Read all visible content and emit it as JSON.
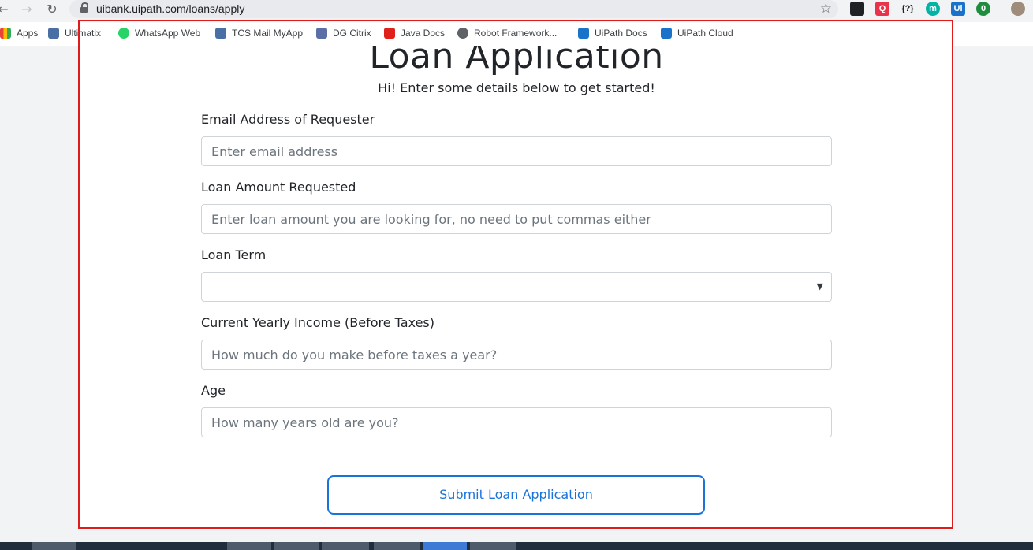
{
  "browser": {
    "url": "uibank.uipath.com/loans/apply",
    "extensions": [
      "Q",
      "{?}",
      "m",
      "Ui",
      "0"
    ]
  },
  "bookmarks": [
    {
      "label": "Apps",
      "icon": "apps-grid-icon"
    },
    {
      "label": "Ultimatix",
      "icon": "tata-icon"
    },
    {
      "label": "WhatsApp Web",
      "icon": "whatsapp-icon"
    },
    {
      "label": "TCS Mail MyApp",
      "icon": "tata-icon"
    },
    {
      "label": "DG Citrix",
      "icon": "lock-icon"
    },
    {
      "label": "Java Docs",
      "icon": "oracle-icon"
    },
    {
      "label": "Robot Framework...",
      "icon": "globe-icon"
    },
    {
      "label": "UiPath Docs",
      "icon": "uipath-icon"
    },
    {
      "label": "UiPath Cloud",
      "icon": "uipath-icon"
    }
  ],
  "form": {
    "title": "Loan Application",
    "subtitle": "Hi! Enter some details below to get started!",
    "email": {
      "label": "Email Address of Requester",
      "placeholder": "Enter email address"
    },
    "amount": {
      "label": "Loan Amount Requested",
      "placeholder": "Enter loan amount you are looking for, no need to put commas either"
    },
    "term": {
      "label": "Loan Term",
      "value": ""
    },
    "income": {
      "label": "Current Yearly Income (Before Taxes)",
      "placeholder": "How much do you make before taxes a year?"
    },
    "age": {
      "label": "Age",
      "placeholder": "How many years old are you?"
    },
    "submit_label": "Submit Loan Application"
  },
  "colors": {
    "accent": "#1a73d9",
    "highlight": "#e01b1b"
  }
}
